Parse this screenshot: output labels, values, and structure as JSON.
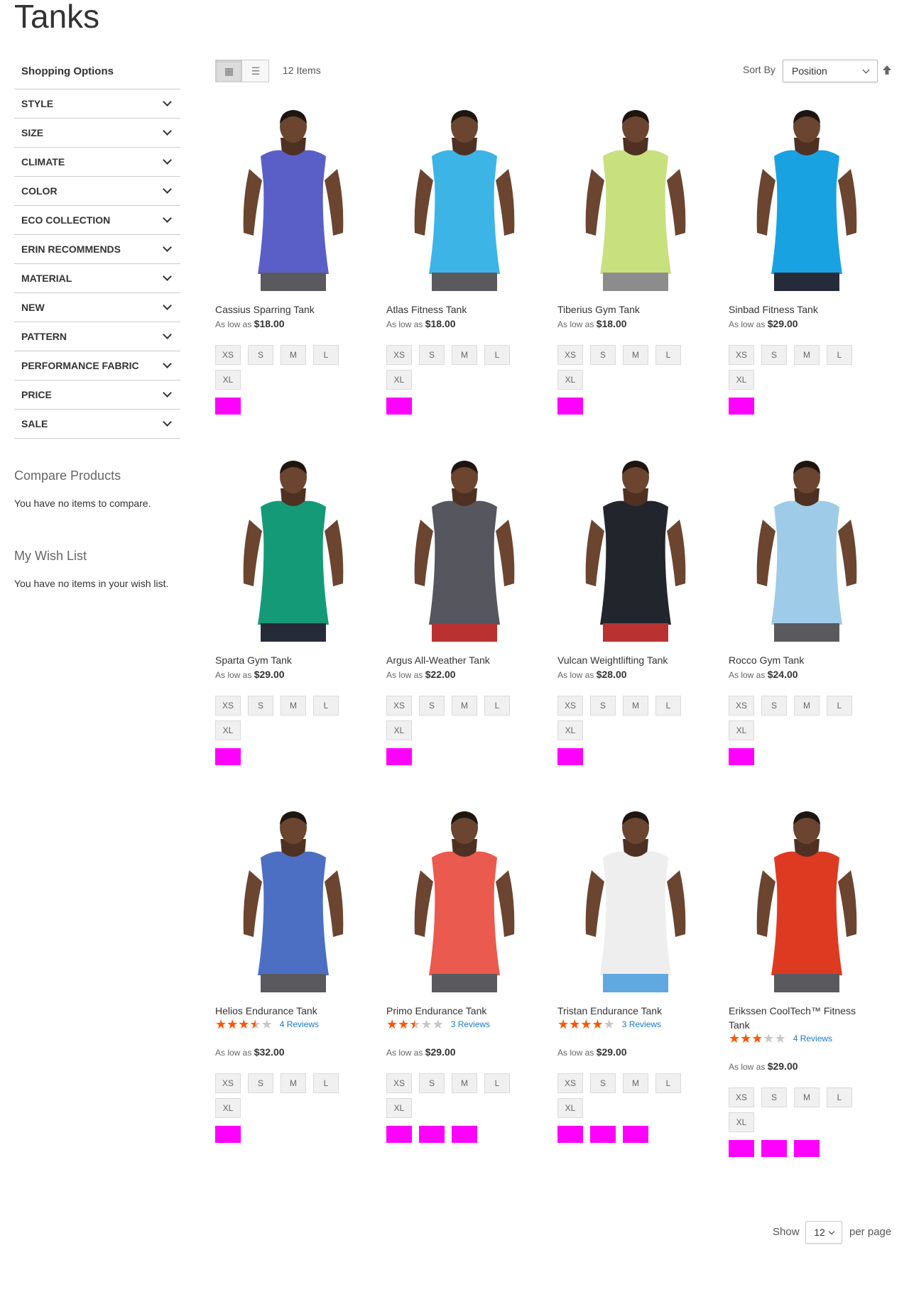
{
  "page": {
    "title": "Tanks"
  },
  "sidebar": {
    "shopping_options": "Shopping Options",
    "filters": [
      "STYLE",
      "SIZE",
      "CLIMATE",
      "COLOR",
      "ECO COLLECTION",
      "ERIN RECOMMENDS",
      "MATERIAL",
      "NEW",
      "PATTERN",
      "PERFORMANCE FABRIC",
      "PRICE",
      "SALE"
    ],
    "compare": {
      "title": "Compare Products",
      "text": "You have no items to compare."
    },
    "wishlist": {
      "title": "My Wish List",
      "text": "You have no items in your wish list."
    }
  },
  "toolbar": {
    "item_count": "12 Items",
    "sort_label": "Sort By",
    "sort_value": "Position",
    "show_label": "Show",
    "limit_value": "12",
    "per_page_label": "per page"
  },
  "price_prefix": "As low as",
  "sizes": [
    "XS",
    "S",
    "M",
    "L",
    "XL"
  ],
  "swatch_color": "#ff00ff",
  "star_color": "#ff5501",
  "products": [
    {
      "name": "Cassius Sparring Tank",
      "price": "$18.00",
      "shirt": "#5a5fc7",
      "pants": "#5a5a5e",
      "swatches": 1
    },
    {
      "name": "Atlas Fitness Tank",
      "price": "$18.00",
      "shirt": "#3cb4e6",
      "pants": "#5a5a5e",
      "swatches": 1
    },
    {
      "name": "Tiberius Gym Tank",
      "price": "$18.00",
      "shirt": "#c8e07e",
      "pants": "#8c8c8c",
      "swatches": 1
    },
    {
      "name": "Sinbad Fitness Tank",
      "price": "$29.00",
      "shirt": "#19a2e2",
      "pants": "#262b3a",
      "swatches": 1
    },
    {
      "name": "Sparta Gym Tank",
      "price": "$29.00",
      "shirt": "#159a78",
      "pants": "#262b3a",
      "swatches": 1
    },
    {
      "name": "Argus All-Weather Tank",
      "price": "$22.00",
      "shirt": "#55565e",
      "pants": "#b83232",
      "swatches": 1
    },
    {
      "name": "Vulcan Weightlifting Tank",
      "price": "$28.00",
      "shirt": "#23252c",
      "pants": "#b83232",
      "swatches": 1
    },
    {
      "name": "Rocco Gym Tank",
      "price": "$24.00",
      "shirt": "#9ecbe8",
      "pants": "#5a5a5e",
      "swatches": 1
    },
    {
      "name": "Helios Endurance Tank",
      "price": "$32.00",
      "shirt": "#4c6fc4",
      "pants": "#5a5a5e",
      "swatches": 1,
      "rating": 3.5,
      "reviews": "4 Reviews"
    },
    {
      "name": "Primo Endurance Tank",
      "price": "$29.00",
      "shirt": "#ea5a4e",
      "pants": "#5a5a5e",
      "swatches": 3,
      "rating": 2.5,
      "reviews": "3 Reviews"
    },
    {
      "name": "Tristan Endurance Tank",
      "price": "$29.00",
      "shirt": "#eeeeee",
      "pants": "#5fa8e0",
      "swatches": 3,
      "rating": 4,
      "reviews": "3 Reviews"
    },
    {
      "name": "Erikssen CoolTech™ Fitness Tank",
      "price": "$29.00",
      "shirt": "#de3a22",
      "pants": "#5a5a5e",
      "swatches": 3,
      "rating": 3,
      "reviews": "4 Reviews"
    }
  ]
}
